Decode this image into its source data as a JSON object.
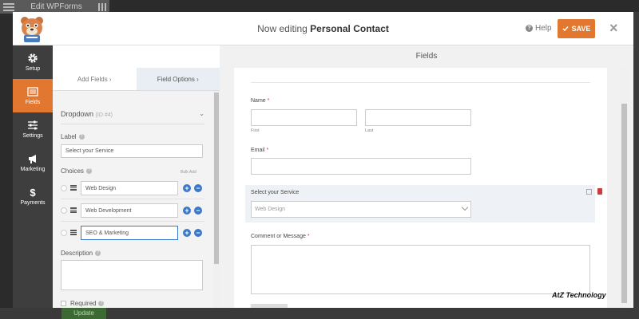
{
  "background": {
    "window_title": "Edit WPForms",
    "bottom_button": "Update"
  },
  "topbar": {
    "title_prefix": "Now editing ",
    "form_name": "Personal Contact",
    "help_label": "Help",
    "save_label": "SAVE"
  },
  "nav": [
    {
      "label": "Setup",
      "icon": "gear-icon"
    },
    {
      "label": "Fields",
      "icon": "list-icon"
    },
    {
      "label": "Settings",
      "icon": "sliders-icon"
    },
    {
      "label": "Marketing",
      "icon": "megaphone-icon"
    },
    {
      "label": "Payments",
      "icon": "dollar-icon"
    }
  ],
  "fields_header": "Fields",
  "panel": {
    "tabs": [
      "Add Fields  ›",
      "Field Options  ›"
    ],
    "field_type": "Dropdown",
    "field_id": "(ID #4)",
    "label_title": "Label",
    "label_value": "Select your Service",
    "choices_title": "Choices",
    "bulk_add": "Bulk Add",
    "choices": [
      "Web Design",
      "Web Development",
      "SEO & Marketing"
    ],
    "description_title": "Description",
    "required_title": "Required"
  },
  "preview": {
    "name_label": "Name",
    "first_label": "First",
    "last_label": "Last",
    "email_label": "Email",
    "service_label": "Select your Service",
    "service_value": "Web Design",
    "message_label": "Comment or Message",
    "required_mark": "*"
  },
  "watermark": "AtZ Technology",
  "colors": {
    "accent": "#e27730",
    "nav": "#3e3e3e",
    "link": "#3a78c9"
  }
}
